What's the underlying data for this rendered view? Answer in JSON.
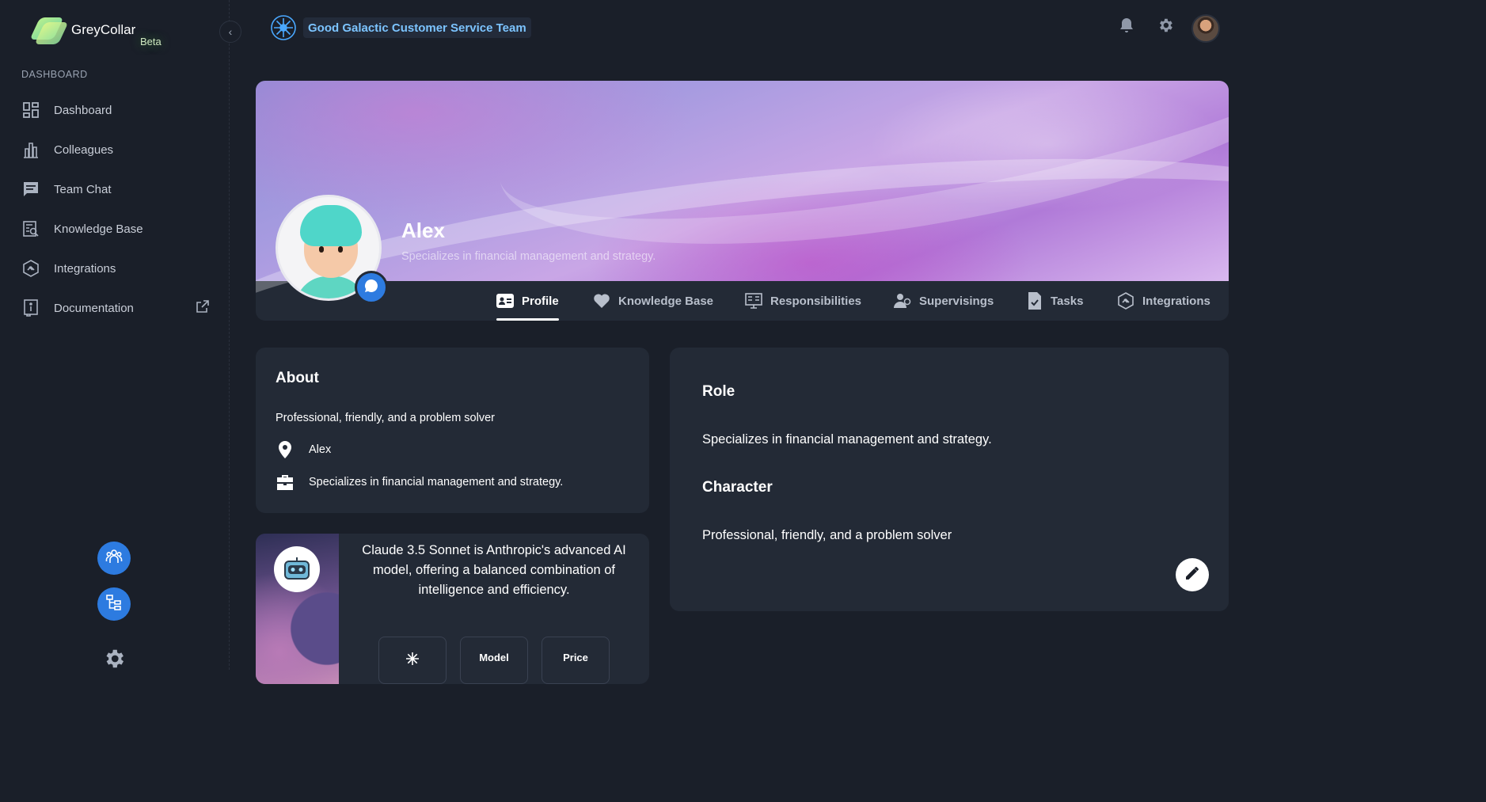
{
  "brand": {
    "name": "GreyCollar",
    "badge": "Beta"
  },
  "sidebar": {
    "section_label": "DASHBOARD",
    "items": [
      {
        "label": "Dashboard",
        "icon": "dashboard-icon"
      },
      {
        "label": "Colleagues",
        "icon": "colleagues-icon"
      },
      {
        "label": "Team Chat",
        "icon": "chat-icon"
      },
      {
        "label": "Knowledge Base",
        "icon": "knowledge-base-icon"
      },
      {
        "label": "Integrations",
        "icon": "integrations-icon"
      },
      {
        "label": "Documentation",
        "icon": "documentation-icon",
        "external": true
      }
    ]
  },
  "topbar": {
    "team_name": "Good Galactic Customer Service Team",
    "icons": [
      "bell-icon",
      "gear-icon",
      "user-avatar"
    ]
  },
  "profile": {
    "name": "Alex",
    "subtitle": "Specializes in financial management and strategy.",
    "tabs": [
      {
        "label": "Profile",
        "active": true
      },
      {
        "label": "Knowledge Base"
      },
      {
        "label": "Responsibilities"
      },
      {
        "label": "Supervisings"
      },
      {
        "label": "Tasks"
      },
      {
        "label": "Integrations"
      }
    ]
  },
  "about": {
    "title": "About",
    "description": "Professional, friendly, and a problem solver",
    "location": "Alex",
    "role": "Specializes in financial management and strategy."
  },
  "model": {
    "description": "Claude 3.5 Sonnet is Anthropic's advanced AI model, offering a balanced combination of intelligence and efficiency.",
    "pill_model": "Model",
    "pill_price": "Price"
  },
  "details": {
    "role_title": "Role",
    "role_text": "Specializes in financial management and strategy.",
    "character_title": "Character",
    "character_text": "Professional, friendly, and a problem solver"
  },
  "colors": {
    "accent": "#2d7be0",
    "team_name": "#7cc4ff",
    "background": "#1a1f29",
    "card": "#232a36"
  }
}
